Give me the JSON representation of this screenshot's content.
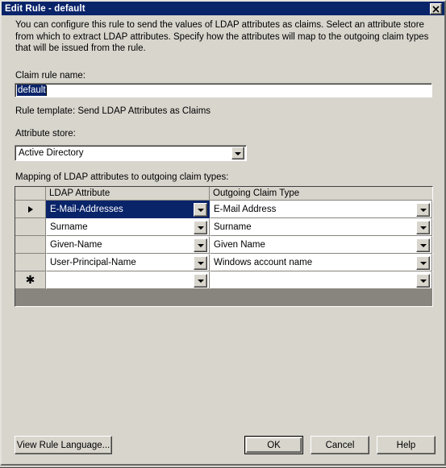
{
  "window": {
    "title": "Edit Rule - default",
    "close_label": "close-icon"
  },
  "body": {
    "intro": "You can configure this rule to send the values of LDAP attributes as claims. Select an attribute store from which to extract LDAP attributes. Specify how the attributes will map to the outgoing claim types that will be issued from the rule.",
    "claim_rule_name_label": "Claim rule name:",
    "claim_rule_name_value": "default",
    "rule_template_text": "Rule template: Send LDAP Attributes as Claims",
    "attribute_store_label": "Attribute store:",
    "attribute_store_value": "Active Directory",
    "mapping_label": "Mapping of LDAP attributes to outgoing claim types:"
  },
  "grid": {
    "columns": [
      "",
      "LDAP Attribute",
      "Outgoing Claim Type"
    ],
    "rows": [
      {
        "marker": "current",
        "ldap_attribute": "E-Mail-Addresses",
        "outgoing_claim_type": "E-Mail Address",
        "selected": true
      },
      {
        "marker": "",
        "ldap_attribute": "Surname",
        "outgoing_claim_type": "Surname",
        "selected": false
      },
      {
        "marker": "",
        "ldap_attribute": "Given-Name",
        "outgoing_claim_type": "Given Name",
        "selected": false
      },
      {
        "marker": "",
        "ldap_attribute": "User-Principal-Name",
        "outgoing_claim_type": "Windows account name",
        "selected": false
      },
      {
        "marker": "new",
        "ldap_attribute": "",
        "outgoing_claim_type": "",
        "selected": false
      }
    ]
  },
  "buttons": {
    "view_rule_language": "View Rule Language...",
    "ok": "OK",
    "cancel": "Cancel",
    "help": "Help"
  },
  "colors": {
    "titlebar": "#0a246a",
    "dialog_face": "#d8d5cd",
    "selection": "#0a246a",
    "grid_filler": "#87857e"
  }
}
